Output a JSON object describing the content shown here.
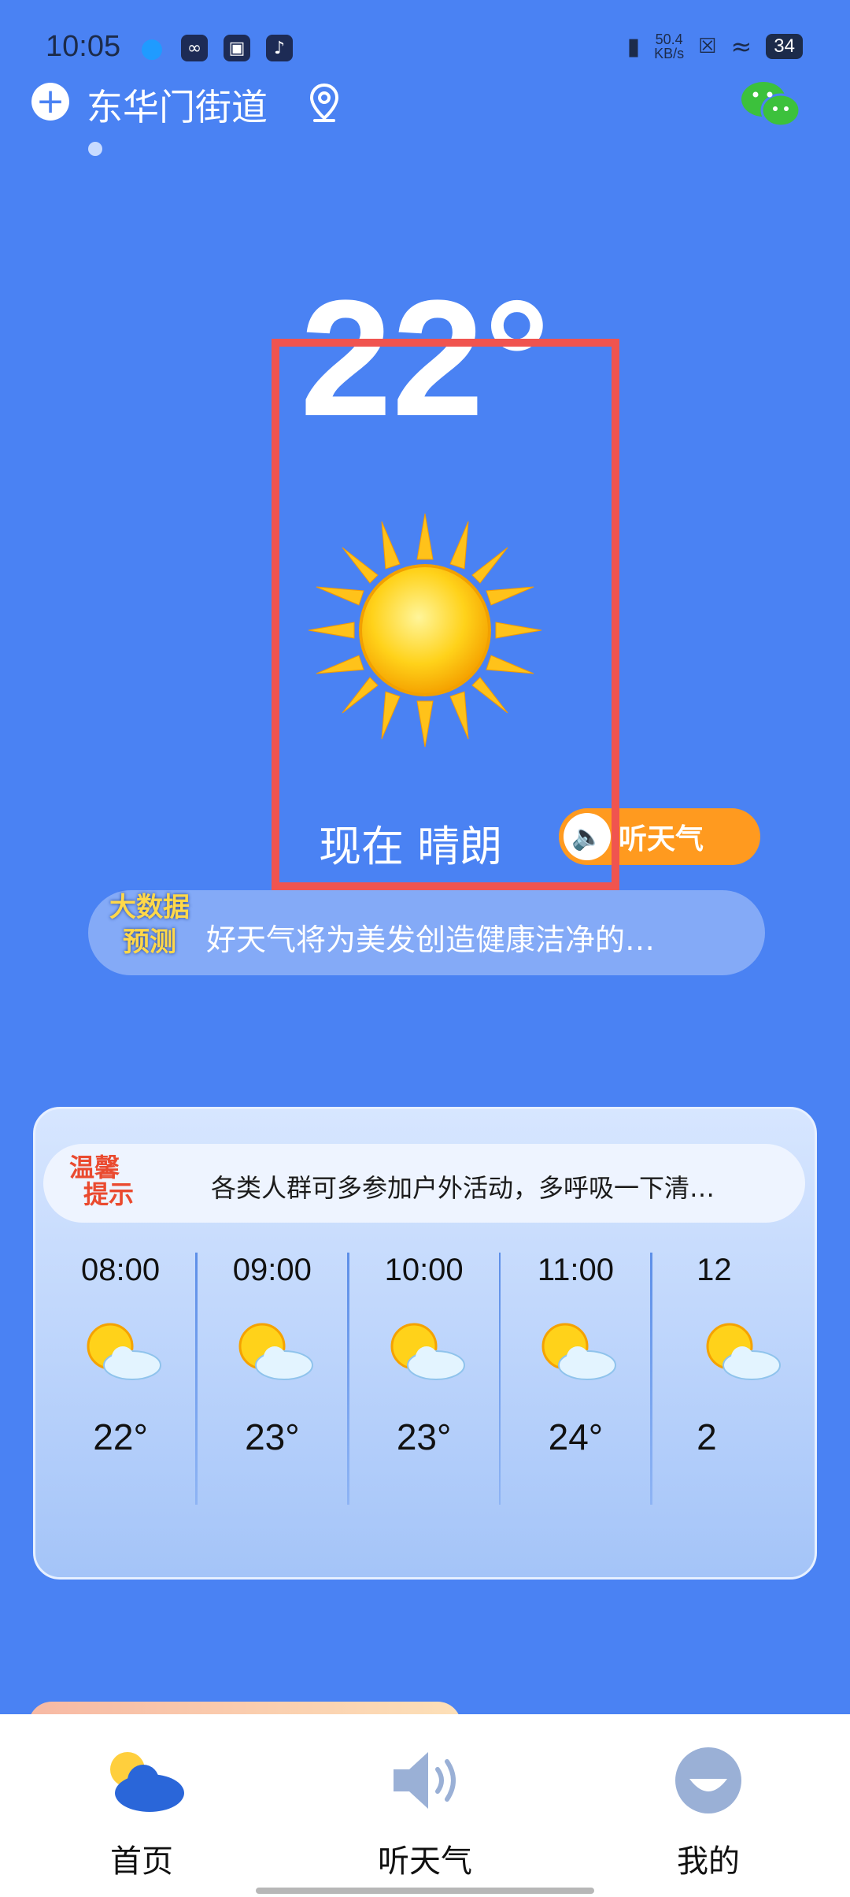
{
  "status_bar": {
    "time": "10:05",
    "net_speed": "50.4",
    "net_unit": "KB/s",
    "battery": "34"
  },
  "header": {
    "location": "东华门街道"
  },
  "current": {
    "temperature": "22°",
    "condition": "现在 晴朗",
    "listen_label": "听天气"
  },
  "bigdata": {
    "badge_line1": "大数据",
    "badge_line2": "预测",
    "text": "好天气将为美发创造健康洁净的…"
  },
  "tip": {
    "badge_line1": "温馨",
    "badge_line2": "提示",
    "text": "各类人群可多参加户外活动，多呼吸一下清…"
  },
  "hourly": [
    {
      "time": "08:00",
      "temp": "22°",
      "icon": "partly-sunny-icon"
    },
    {
      "time": "09:00",
      "temp": "23°",
      "icon": "partly-sunny-icon"
    },
    {
      "time": "10:00",
      "temp": "23°",
      "icon": "partly-sunny-icon"
    },
    {
      "time": "11:00",
      "temp": "24°",
      "icon": "partly-sunny-icon"
    },
    {
      "time": "12",
      "temp": "2",
      "icon": "partly-sunny-icon"
    }
  ],
  "nav": [
    {
      "label": "首页",
      "icon": "home-weather-icon"
    },
    {
      "label": "听天气",
      "icon": "speaker-icon"
    },
    {
      "label": "我的",
      "icon": "profile-icon"
    }
  ],
  "colors": {
    "background": "#4A82F3",
    "accent_orange": "#FF9A1F",
    "highlight_red": "#F0544F"
  }
}
